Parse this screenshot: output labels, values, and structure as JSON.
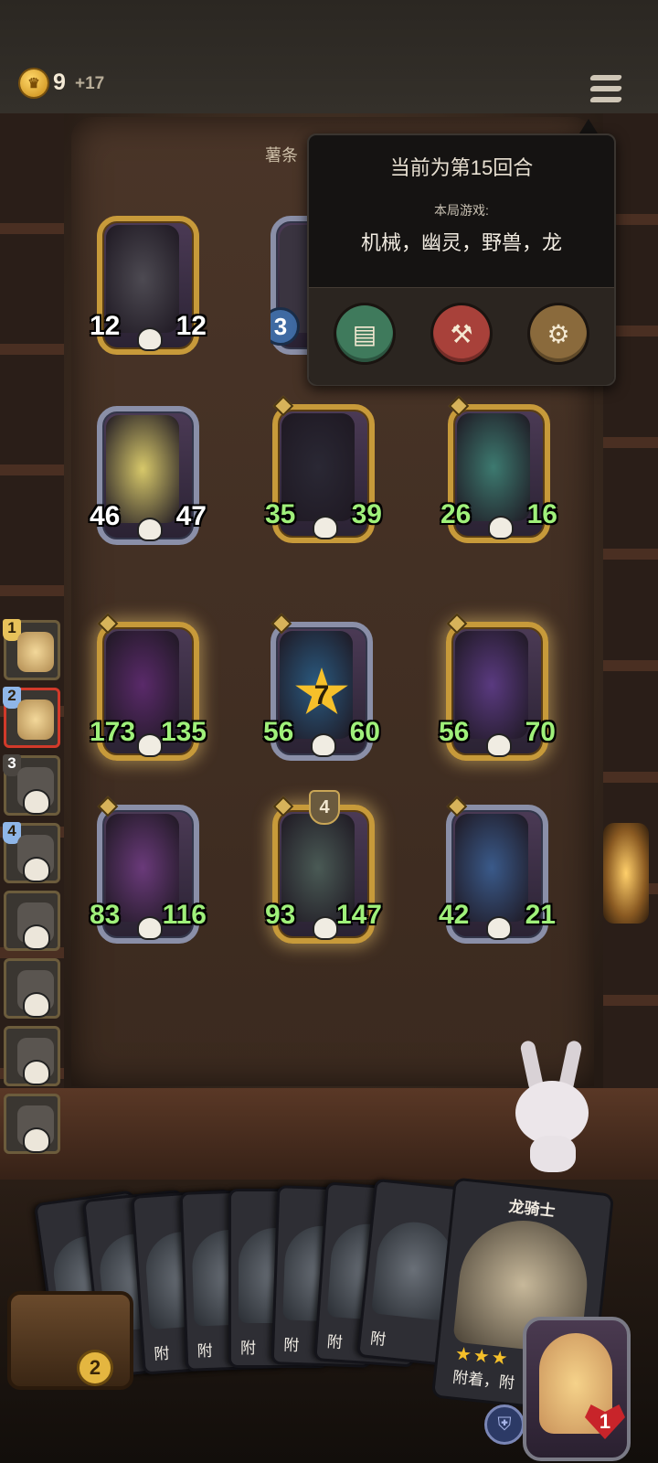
{
  "top": {
    "gold": "9",
    "gold_income": "+17"
  },
  "sign_text": "薯条",
  "popup": {
    "title": "当前为第15回合",
    "tribes_label": "本局游戏:",
    "tribes": "机械，幽灵，野兽，龙",
    "buttons": [
      {
        "icon": "book-icon",
        "color": "#3f7a5c"
      },
      {
        "icon": "axe-icon",
        "color": "#a8413a"
      },
      {
        "icon": "gear-icon",
        "color": "#8a6a3c"
      }
    ]
  },
  "board": {
    "units": [
      {
        "name": "pumpkin-unit",
        "atk": "12",
        "hp": "12",
        "frame": "gold",
        "atk_buff": false,
        "hp_buff": false,
        "bg": "#4d4a52"
      },
      {
        "name": "partial-unit",
        "badge": "3",
        "frame": "silver"
      },
      {
        "name": "spirit-unit",
        "atk": "46",
        "hp": "47",
        "frame": "silver",
        "bg": "#d7c86a"
      },
      {
        "name": "reaper-unit",
        "atk": "35",
        "hp": "39",
        "frame": "gold",
        "atk_buff": true,
        "hp_buff": true,
        "bg": "#2a2834"
      },
      {
        "name": "ghost-unit",
        "atk": "26",
        "hp": "16",
        "frame": "gold",
        "atk_buff": true,
        "hp_buff": true,
        "bg": "#3d7a70"
      },
      {
        "name": "dark-knight-unit",
        "atk": "173",
        "hp": "135",
        "frame": "gold",
        "atk_buff": true,
        "hp_buff": true,
        "bg": "#5a2a6a"
      },
      {
        "name": "octopus-unit",
        "atk": "56",
        "hp": "60",
        "frame": "silver",
        "atk_buff": true,
        "hp_buff": true,
        "star": "7",
        "bg": "#2a5a80"
      },
      {
        "name": "wizard-unit",
        "atk": "56",
        "hp": "70",
        "frame": "gold",
        "atk_buff": true,
        "hp_buff": true,
        "bg": "#5a3a80"
      },
      {
        "name": "fairy-unit",
        "atk": "83",
        "hp": "116",
        "frame": "silver",
        "atk_buff": true,
        "hp_buff": true,
        "bg": "#6a3a7a"
      },
      {
        "name": "robot-unit",
        "atk": "93",
        "hp": "147",
        "frame": "gold",
        "atk_buff": true,
        "hp_buff": true,
        "level": "4",
        "bg": "#4a5a55"
      },
      {
        "name": "paladin-unit",
        "atk": "42",
        "hp": "21",
        "frame": "silver",
        "atk_buff": true,
        "hp_buff": true,
        "bg": "#3a5a8a"
      }
    ]
  },
  "ranking": [
    {
      "rank": "1",
      "style": "gold"
    },
    {
      "rank": "2",
      "style": "blue",
      "me": true
    },
    {
      "rank": "3",
      "style": "dark"
    },
    {
      "rank": "4",
      "style": "blue"
    },
    {
      "rank": "",
      "style": "none"
    },
    {
      "rank": "",
      "style": "none"
    },
    {
      "rank": "",
      "style": "none"
    },
    {
      "rank": "",
      "style": "none"
    }
  ],
  "hand": {
    "small_cards": [
      "附",
      "附",
      "附",
      "附",
      "附",
      "附",
      "附",
      "附"
    ],
    "big_card": {
      "name": "龙骑士",
      "stars": "★★★",
      "desc": "附着，附"
    }
  },
  "shop_chest_count": "2",
  "hero": {
    "health": "1"
  }
}
